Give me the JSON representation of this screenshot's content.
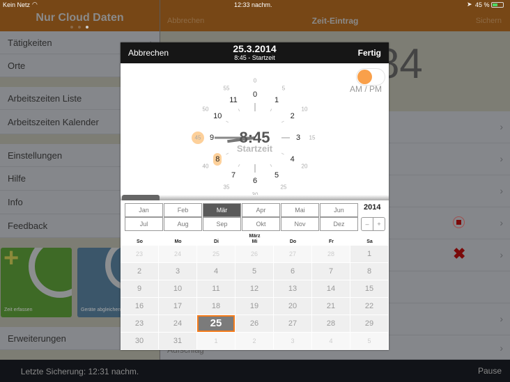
{
  "status_bar": {
    "carrier": "Kein Netz",
    "time": "12:33 nachm.",
    "battery": "45 %"
  },
  "left": {
    "title": "Nur Cloud Daten",
    "page_dots": 3,
    "active_dot": 3,
    "group1": [
      "Tätigkeiten",
      "Orte"
    ],
    "group2": [
      "Arbeitszeiten Liste",
      "Arbeitszeiten Kalender"
    ],
    "group3": [
      "Einstellungen",
      "Hilfe",
      "Info",
      "Feedback"
    ],
    "tiles": [
      {
        "label": "Zeit erfassen",
        "color": "#3e6a26"
      },
      {
        "label": "Geräte abgleichen",
        "color": "#3b566a"
      }
    ],
    "extensions": "Erweiterungen",
    "footer": "Letzte Sicherung: 12:31 nachm."
  },
  "right": {
    "cancel": "Abbrechen",
    "title": "Zeit-Eintrag",
    "save": "Sichern",
    "big_value": "84",
    "last_row": "Aufschlag",
    "pause": "Pause"
  },
  "dialog": {
    "cancel": "Abbrechen",
    "date": "25.3.2014",
    "subtitle": "8:45 - Startzeit",
    "done": "Fertig",
    "ampm_label": "AM / PM",
    "ampm_on": true,
    "clock": {
      "time": "8:45",
      "label": "Startzeit",
      "hour": 8,
      "minute": 45,
      "hours": [
        "0",
        "1",
        "2",
        "3",
        "4",
        "5",
        "6",
        "7",
        "8",
        "9",
        "10",
        "11"
      ],
      "minutes": [
        "0",
        "5",
        "10",
        "15",
        "20",
        "25",
        "30",
        "35",
        "40",
        "45",
        "50",
        "55"
      ]
    },
    "months": [
      "Jan",
      "Feb",
      "Mär",
      "Apr",
      "Mai",
      "Jun",
      "Jul",
      "Aug",
      "Sep",
      "Okt",
      "Nov",
      "Dez"
    ],
    "selected_month": "Mär",
    "year": "2014",
    "year_minus": "–",
    "year_plus": "+",
    "month_title": "März",
    "weekdays": [
      "So",
      "Mo",
      "Di",
      "Mi",
      "Do",
      "Fr",
      "Sa"
    ],
    "days": [
      [
        "23",
        "24",
        "25",
        "26",
        "27",
        "28",
        "1"
      ],
      [
        "2",
        "3",
        "4",
        "5",
        "6",
        "7",
        "8"
      ],
      [
        "9",
        "10",
        "11",
        "12",
        "13",
        "14",
        "15"
      ],
      [
        "16",
        "17",
        "18",
        "19",
        "20",
        "21",
        "22"
      ],
      [
        "23",
        "24",
        "25",
        "26",
        "27",
        "28",
        "29"
      ],
      [
        "30",
        "31",
        "1",
        "2",
        "3",
        "4",
        "5"
      ]
    ],
    "selected_day": "25",
    "accent": "#f9a04a"
  }
}
